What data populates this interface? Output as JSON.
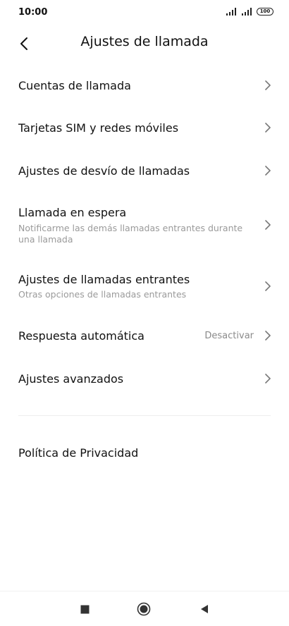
{
  "status_bar": {
    "time": "10:00",
    "battery": "100"
  },
  "header": {
    "title": "Ajustes de llamada"
  },
  "menu": {
    "items": [
      {
        "title": "Cuentas de llamada"
      },
      {
        "title": "Tarjetas SIM y redes móviles"
      },
      {
        "title": "Ajustes de desvío de llamadas"
      },
      {
        "title": "Llamada en espera",
        "subtitle": "Notificarme las demás llamadas entrantes durante una llamada"
      },
      {
        "title": "Ajustes de llamadas entrantes",
        "subtitle": "Otras opciones de llamadas entrantes"
      },
      {
        "title": "Respuesta automática",
        "value": "Desactivar"
      },
      {
        "title": "Ajustes avanzados"
      }
    ],
    "privacy": "Política de Privacidad"
  },
  "colors": {
    "text": "#111111",
    "secondary": "#9a9a9a",
    "chevron": "#777777"
  }
}
